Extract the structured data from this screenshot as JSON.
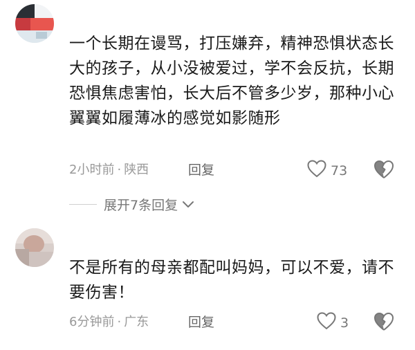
{
  "comments": [
    {
      "text": "一个长期在谩骂，打压嫌弃，精神恐惧状态长大的孩子，从小没被爱过，学不会反抗，长期恐惧焦虑害怕，长大后不管多少岁，那种小心翼翼如履薄冰的感觉如影随形",
      "time": "2小时前",
      "separator": "·",
      "location": "陕西",
      "reply_label": "回复",
      "likes": "73",
      "avatar_icon": "blurred-avatar"
    },
    {
      "text": "不是所有的母亲都配叫妈妈，可以不爱，请不要伤害！",
      "time": "6分钟前",
      "separator": "·",
      "location": "广东",
      "reply_label": "回复",
      "likes": "3",
      "avatar_icon": "blurred-avatar"
    }
  ],
  "expand_replies_label": "展开7条回复",
  "icons": {
    "like": "heart-outline-icon",
    "dislike": "broken-heart-icon",
    "expand": "chevron-down-icon"
  },
  "colors": {
    "text": "#1a1a1a",
    "meta": "#999999",
    "icon": "#777777"
  }
}
